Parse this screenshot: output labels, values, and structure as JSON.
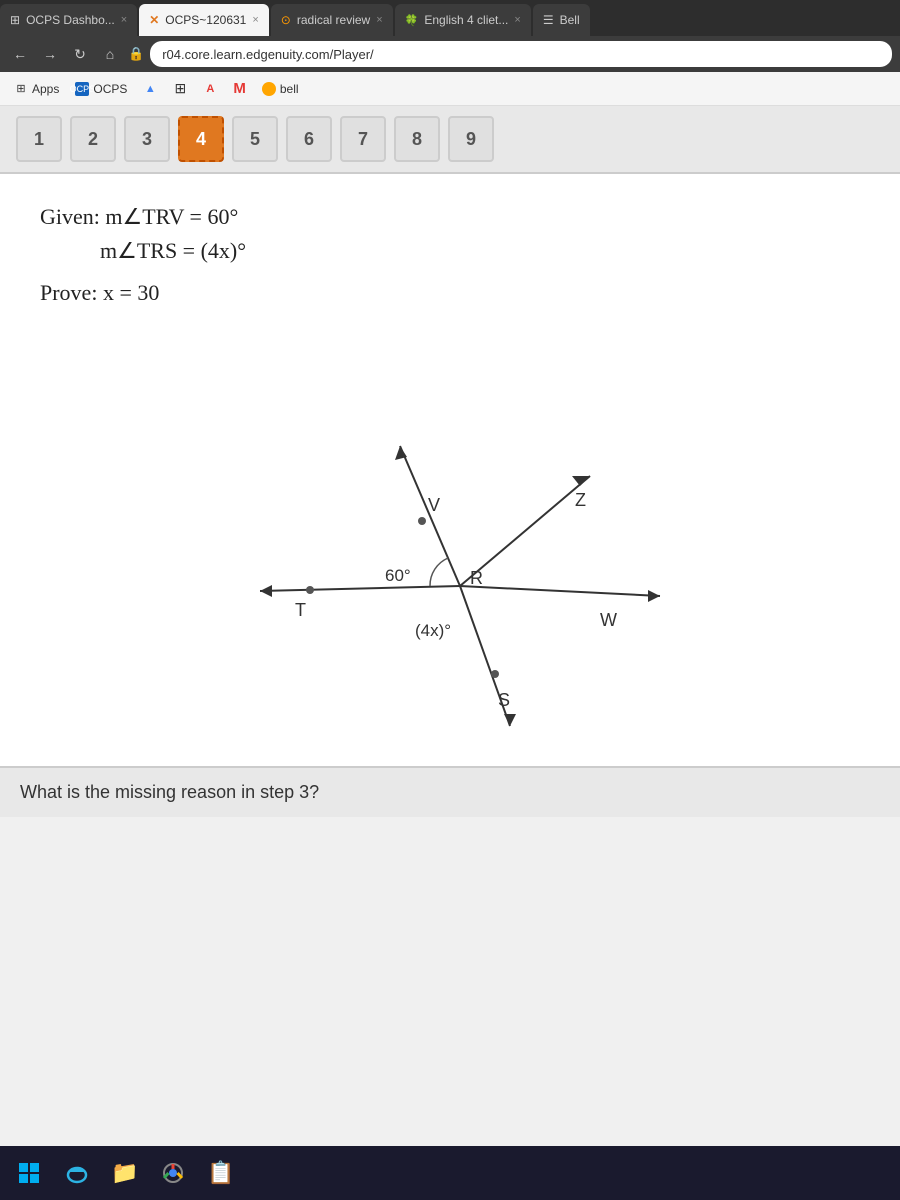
{
  "tabs": [
    {
      "id": "tab1",
      "label": "OCPS Dashbo...",
      "icon": "grid",
      "active": false,
      "close": true
    },
    {
      "id": "tab2",
      "label": "OCPS~120631",
      "icon": "x-star",
      "active": true,
      "close": true
    },
    {
      "id": "tab3",
      "label": "radical review",
      "icon": "circle-dot",
      "active": false,
      "close": true
    },
    {
      "id": "tab4",
      "label": "English 4 cliet...",
      "icon": "leaf",
      "active": false,
      "close": true
    },
    {
      "id": "tab5",
      "label": "Bell",
      "icon": "lines",
      "active": false,
      "close": false
    }
  ],
  "address_bar": {
    "url": "r04.core.learn.edgenuity.com/Player/"
  },
  "bookmarks": [
    {
      "label": "Apps",
      "icon": "grid"
    },
    {
      "label": "OCPS",
      "icon": "doc"
    },
    {
      "label": "",
      "icon": "triangle"
    },
    {
      "label": "",
      "icon": "grid2"
    },
    {
      "label": "",
      "icon": "letter-a"
    },
    {
      "label": "M",
      "icon": ""
    },
    {
      "label": "bell",
      "icon": "circle-orange"
    }
  ],
  "steps": [
    1,
    2,
    3,
    4,
    5,
    6,
    7,
    8,
    9
  ],
  "active_step": 4,
  "problem": {
    "given_line1": "Given: m∠TRV = 60°",
    "given_line2": "m∠TRS = (4x)°",
    "prove_line": "Prove: x = 30"
  },
  "diagram": {
    "labels": [
      "V",
      "Z",
      "R",
      "W",
      "S",
      "T"
    ],
    "angle_60": "60°",
    "angle_4x": "(4x)°"
  },
  "bottom_text": "What is the missing reason in step 3?"
}
